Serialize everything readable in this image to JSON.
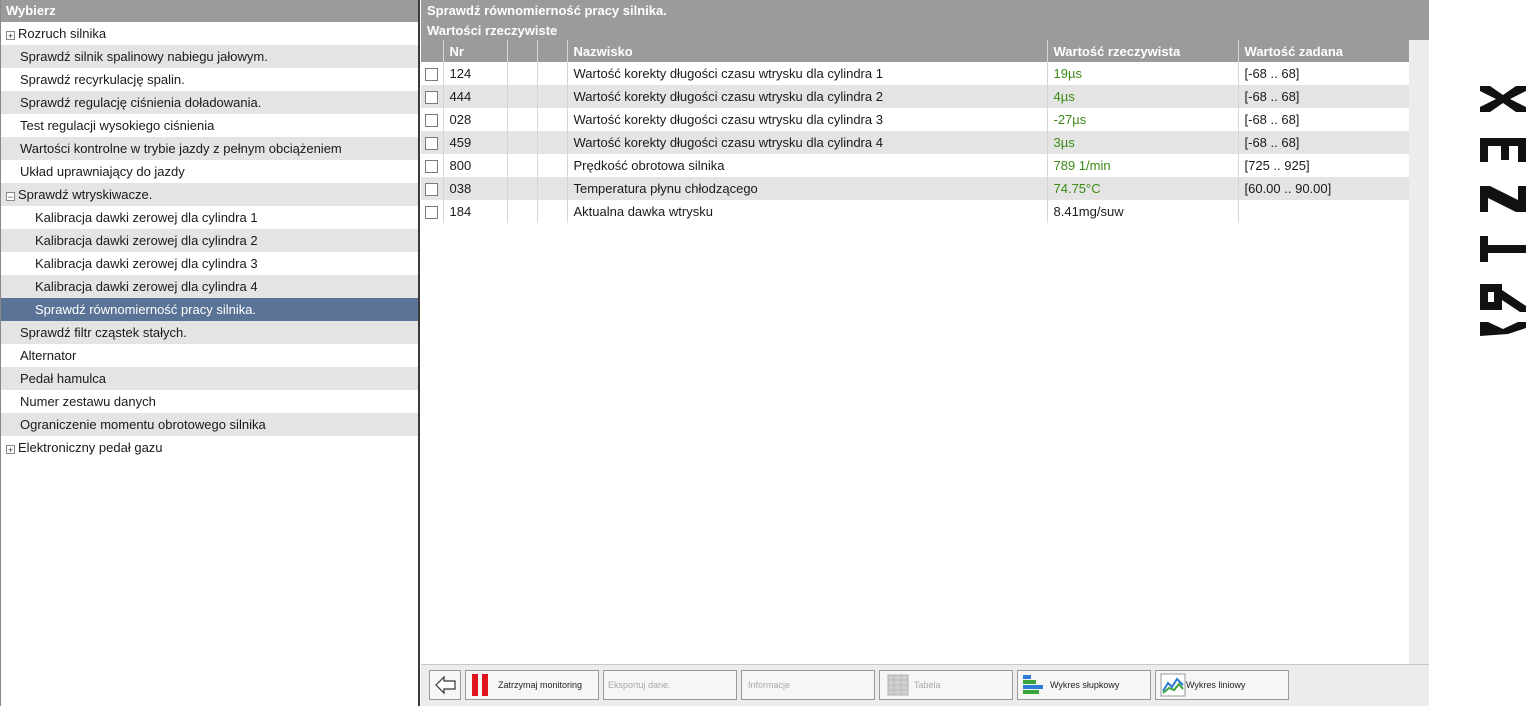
{
  "left": {
    "header": "Wybierz",
    "items": [
      {
        "label": "Rozruch silnika",
        "level": 0,
        "expander": "+"
      },
      {
        "label": "Sprawdź silnik spalinowy nabiegu jałowym.",
        "level": 1
      },
      {
        "label": "Sprawdź recyrkulację spalin.",
        "level": 1
      },
      {
        "label": "Sprawdź regulację ciśnienia doładowania.",
        "level": 1
      },
      {
        "label": "Test regulacji wysokiego ciśnienia",
        "level": 1
      },
      {
        "label": "Wartości kontrolne w trybie jazdy z pełnym obciążeniem",
        "level": 1
      },
      {
        "label": "Układ uprawniający do jazdy",
        "level": 1
      },
      {
        "label": "Sprawdź wtryskiwacze.",
        "level": 0,
        "expander": "−"
      },
      {
        "label": "Kalibracja dawki zerowej dla cylindra 1",
        "level": 2
      },
      {
        "label": "Kalibracja dawki zerowej dla cylindra 2",
        "level": 2
      },
      {
        "label": "Kalibracja dawki zerowej dla cylindra 3",
        "level": 2
      },
      {
        "label": "Kalibracja dawki zerowej dla cylindra 4",
        "level": 2
      },
      {
        "label": "Sprawdź równomierność pracy silnika.",
        "level": 2,
        "selected": true
      },
      {
        "label": "Sprawdź filtr cząstek stałych.",
        "level": 1
      },
      {
        "label": "Alternator",
        "level": 1
      },
      {
        "label": "Pedał hamulca",
        "level": 1
      },
      {
        "label": "Numer zestawu danych",
        "level": 1
      },
      {
        "label": "Ograniczenie momentu obrotowego silnika",
        "level": 1
      },
      {
        "label": "Elektroniczny pedał gazu",
        "level": 0,
        "expander": "+"
      }
    ]
  },
  "right": {
    "title": "Sprawdź równomierność pracy silnika.",
    "subtitle": "Wartości rzeczywiste",
    "columns": {
      "nr": "Nr",
      "name": "Nazwisko",
      "actual": "Wartość rzeczywista",
      "target": "Wartość zadana"
    },
    "rows": [
      {
        "nr": "124",
        "name": "Wartość korekty długości czasu wtrysku dla cylindra 1",
        "actual": "19µs",
        "target": "[-68 .. 68]",
        "in_range": true
      },
      {
        "nr": "444",
        "name": "Wartość korekty długości czasu wtrysku dla cylindra 2",
        "actual": "4µs",
        "target": "[-68 .. 68]",
        "in_range": true
      },
      {
        "nr": "028",
        "name": "Wartość korekty długości czasu wtrysku dla cylindra 3",
        "actual": "-27µs",
        "target": "[-68 .. 68]",
        "in_range": true
      },
      {
        "nr": "459",
        "name": "Wartość korekty długości czasu wtrysku dla cylindra 4",
        "actual": "3µs",
        "target": "[-68 .. 68]",
        "in_range": true
      },
      {
        "nr": "800",
        "name": "Prędkość obrotowa silnika",
        "actual": "789 1/min",
        "target": "[725 .. 925]",
        "in_range": true
      },
      {
        "nr": "038",
        "name": "Temperatura płynu chłodzącego",
        "actual": "74.75°C",
        "target": "[60.00 .. 90.00]",
        "in_range": true
      },
      {
        "nr": "184",
        "name": "Aktualna dawka wtrysku",
        "actual": "8.41mg/suw",
        "target": "",
        "in_range": false
      }
    ]
  },
  "toolbar": {
    "back_icon": "arrow-left-icon",
    "stop_label": "Zatrzymaj monitoring",
    "export_label": "Eksportuj dane.",
    "info_label": "Informacje",
    "table_label": "Tabela",
    "bar_label": "Wykres słupkowy",
    "line_label": "Wykres liniowy"
  },
  "brand": {
    "logo": "XENTRY"
  },
  "colors": {
    "header_gray": "#9b9b9b",
    "selected_blue": "#5a7396",
    "ok_green": "#3c8a14",
    "stop_red": "#e0141e"
  }
}
